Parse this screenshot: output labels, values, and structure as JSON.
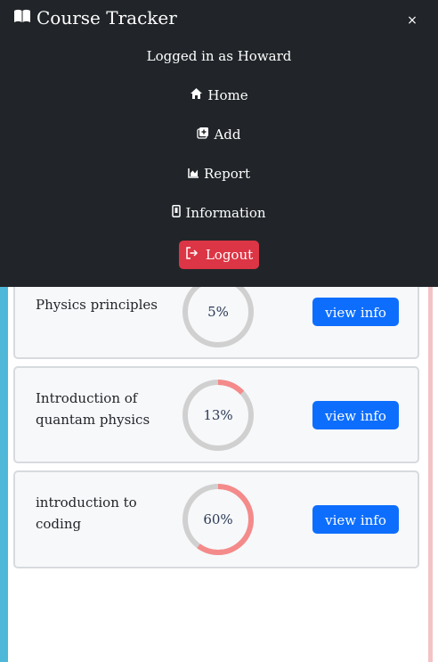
{
  "navbar": {
    "brand": "Course Tracker",
    "user_text": "Logged in as Howard",
    "links": [
      {
        "label": "Home",
        "icon": "home-icon"
      },
      {
        "label": "Add",
        "icon": "add-square-icon"
      },
      {
        "label": "Report",
        "icon": "chart-icon"
      },
      {
        "label": "Information",
        "icon": "phone-icon"
      }
    ],
    "logout_label": "Logout",
    "close_symbol": "×"
  },
  "courses": [
    {
      "title": "Physics principles",
      "progress_text": "5%",
      "progress": 5,
      "button": "view info"
    },
    {
      "title": "Introduction of quantam physics",
      "progress_text": "13%",
      "progress": 13,
      "button": "view info"
    },
    {
      "title": "introduction to coding",
      "progress_text": "60%",
      "progress": 60,
      "button": "view info"
    }
  ],
  "colors": {
    "navbar_bg": "#212529",
    "primary_button": "#0d6efd",
    "danger_button": "#dc3545",
    "progress_ring": "#f58a8a",
    "progress_track": "#d0d0d0"
  }
}
